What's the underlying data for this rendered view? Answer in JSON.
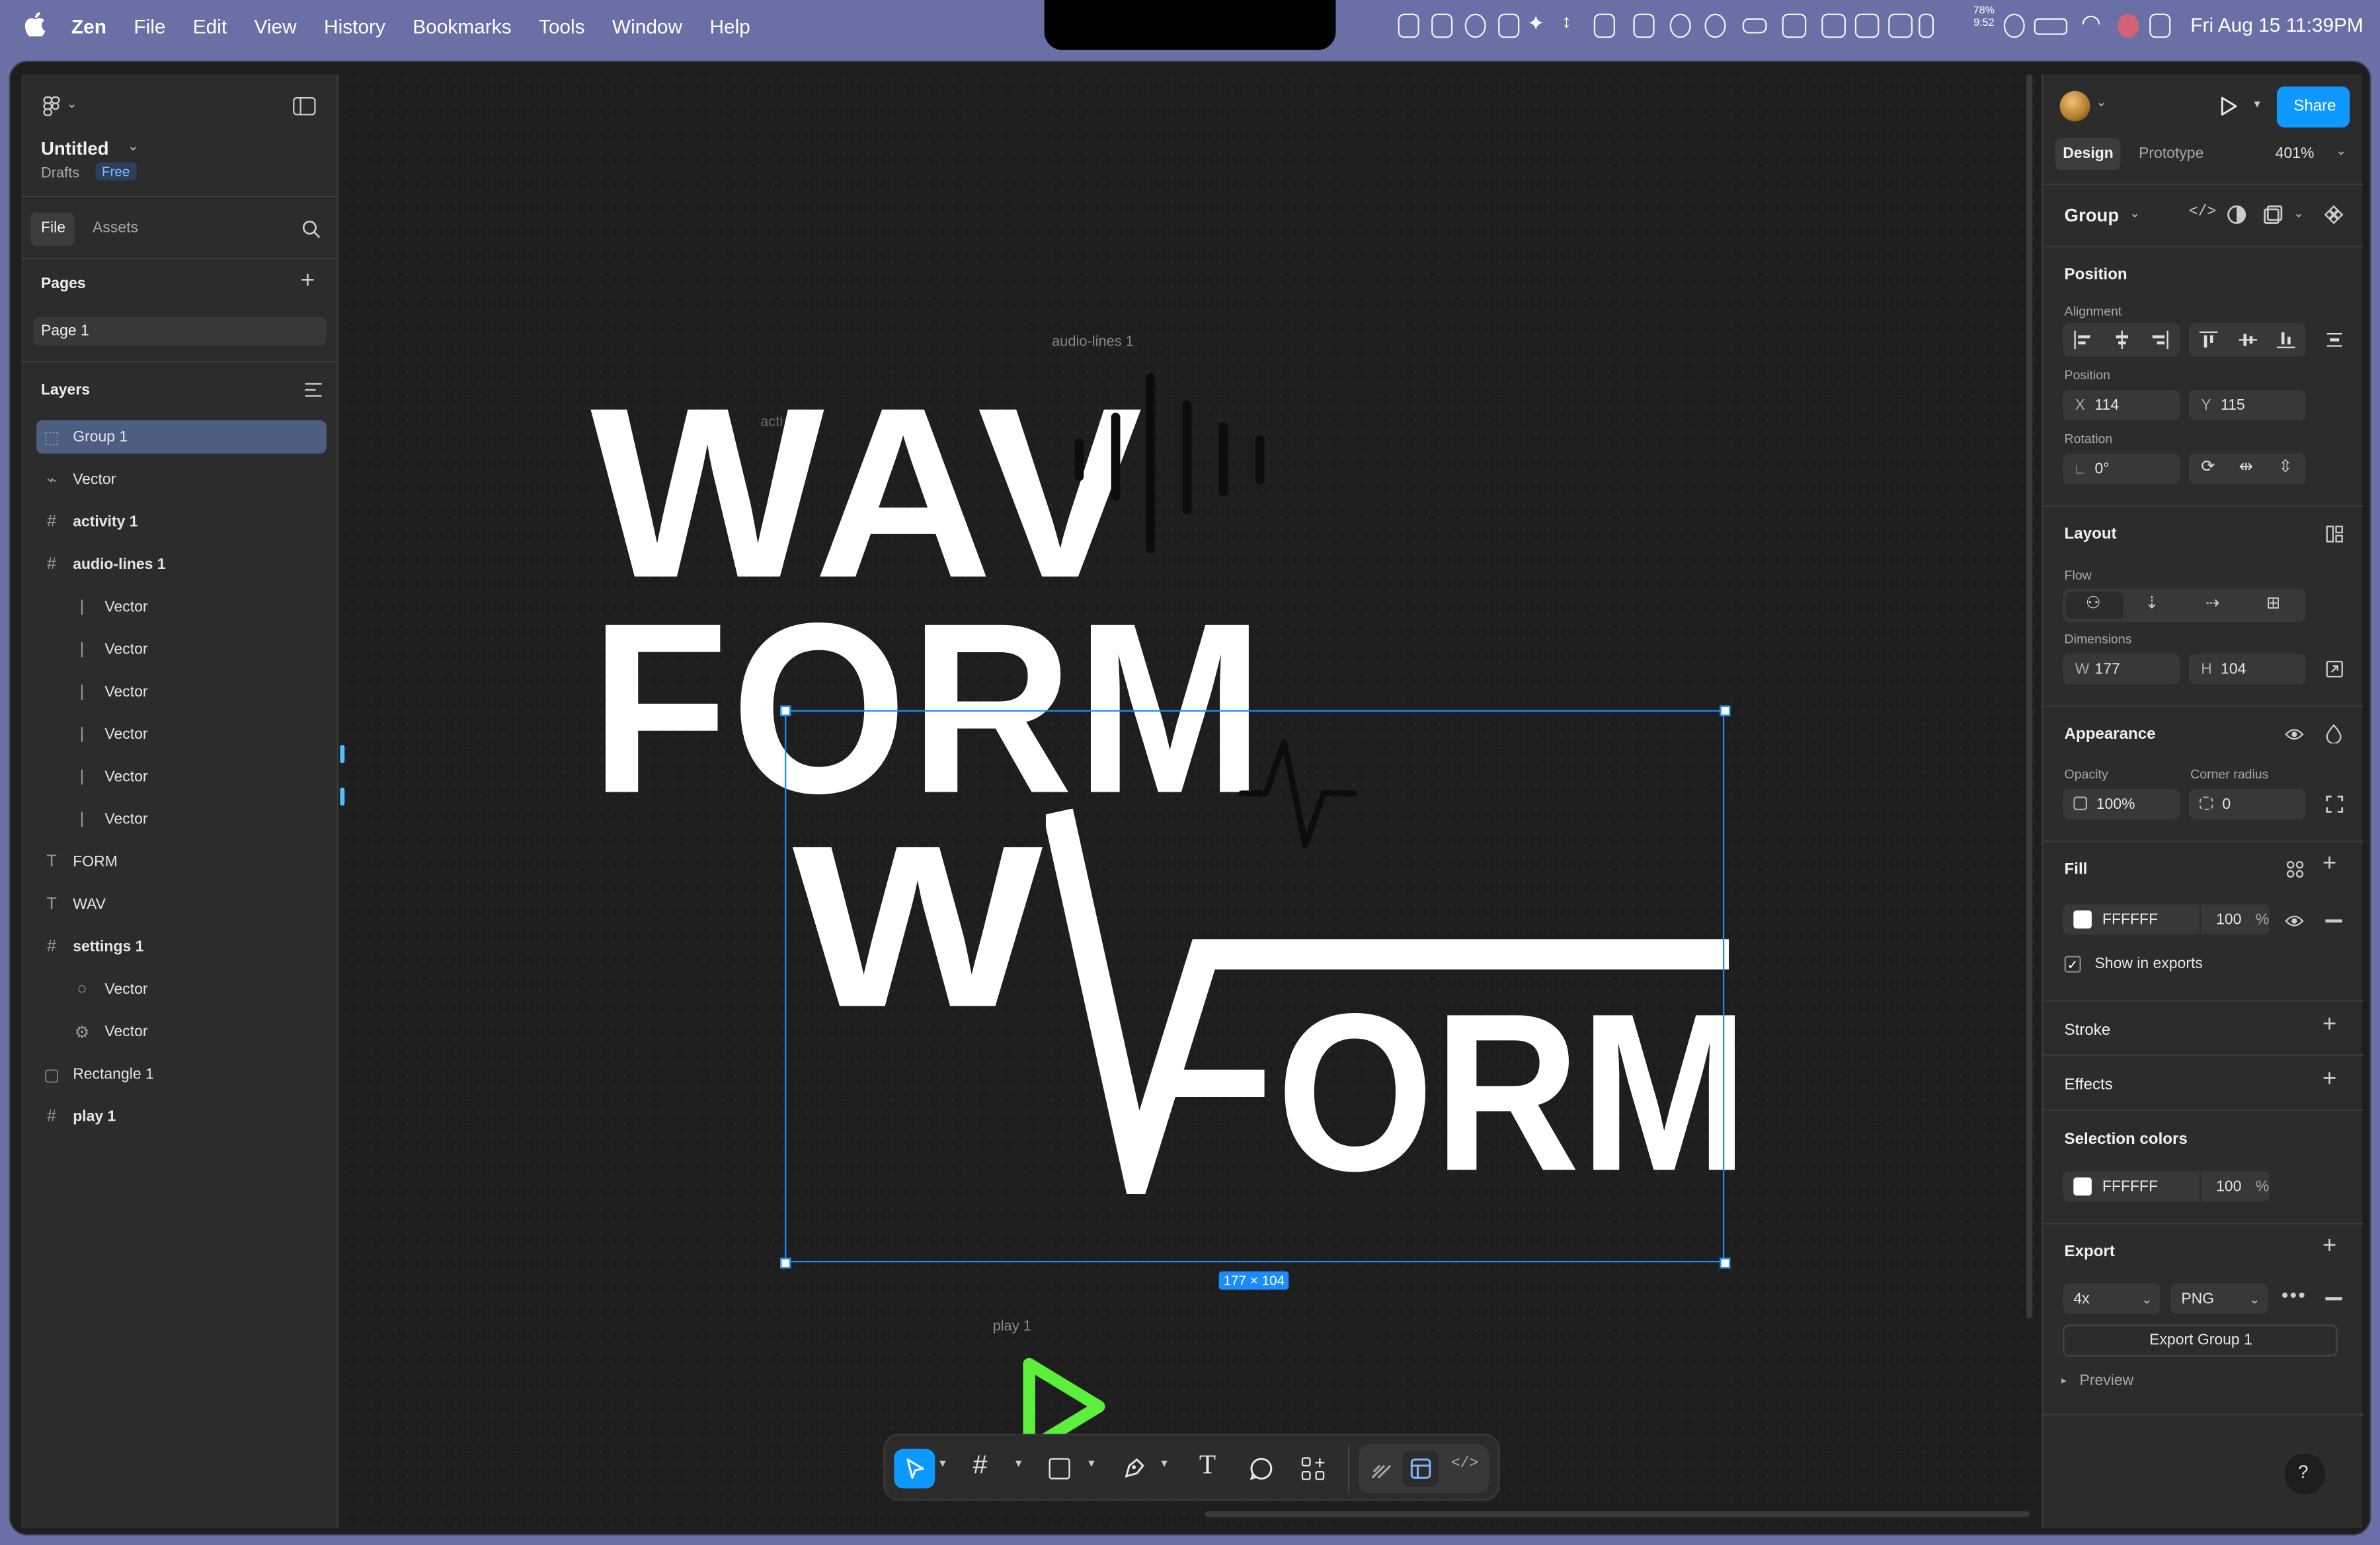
{
  "menubar": {
    "app": "Zen",
    "items": [
      "File",
      "Edit",
      "View",
      "History",
      "Bookmarks",
      "Tools",
      "Window",
      "Help"
    ],
    "battery_pct": "78%",
    "battery_time": "9:52",
    "clock": "Fri Aug 15  11:39PM"
  },
  "file": {
    "title": "Untitled",
    "drafts": "Drafts",
    "plan_badge": "Free"
  },
  "left_tabs": {
    "file": "File",
    "assets": "Assets"
  },
  "pages": {
    "header": "Pages",
    "items": [
      "Page 1"
    ]
  },
  "layers": {
    "header": "Layers",
    "items": [
      {
        "name": "Group 1",
        "glyph": "group-icon",
        "depth": 0,
        "bold": false,
        "selected": true
      },
      {
        "name": "Vector",
        "glyph": "vector-icon",
        "depth": 0,
        "bold": false
      },
      {
        "name": "activity 1",
        "glyph": "frame-icon",
        "depth": 0,
        "bold": true
      },
      {
        "name": "audio-lines 1",
        "glyph": "frame-icon",
        "depth": 0,
        "bold": true
      },
      {
        "name": "Vector",
        "glyph": "line-icon",
        "depth": 1,
        "bold": false
      },
      {
        "name": "Vector",
        "glyph": "line-icon",
        "depth": 1,
        "bold": false
      },
      {
        "name": "Vector",
        "glyph": "line-icon",
        "depth": 1,
        "bold": false
      },
      {
        "name": "Vector",
        "glyph": "line-icon",
        "depth": 1,
        "bold": false
      },
      {
        "name": "Vector",
        "glyph": "line-icon",
        "depth": 1,
        "bold": false
      },
      {
        "name": "Vector",
        "glyph": "line-icon",
        "depth": 1,
        "bold": false
      },
      {
        "name": "FORM",
        "glyph": "text-icon",
        "depth": 0,
        "bold": false
      },
      {
        "name": "WAV",
        "glyph": "text-icon",
        "depth": 0,
        "bold": false
      },
      {
        "name": "settings 1",
        "glyph": "frame-icon",
        "depth": 0,
        "bold": true
      },
      {
        "name": "Vector",
        "glyph": "circle-icon",
        "depth": 1,
        "bold": false
      },
      {
        "name": "Vector",
        "glyph": "gear-icon",
        "depth": 1,
        "bold": false
      },
      {
        "name": "Rectangle 1",
        "glyph": "rectangle-icon",
        "depth": 0,
        "bold": false
      },
      {
        "name": "play 1",
        "glyph": "frame-icon",
        "depth": 0,
        "bold": true
      }
    ]
  },
  "canvas": {
    "frame_label_audio": "audio-lines 1",
    "frame_label_activity": "acti",
    "frame_label_play": "play 1",
    "wav": "WAV",
    "form": "FORM",
    "logo_w": "W",
    "logo_orm": "ORM",
    "size_badge": "177 × 104"
  },
  "right": {
    "share": "Share",
    "tab_design": "Design",
    "tab_prototype": "Prototype",
    "zoom": "401%",
    "selection_type": "Group",
    "position": {
      "header": "Position",
      "alignment_label": "Alignment",
      "position_label": "Position",
      "x_label": "X",
      "x": "114",
      "y_label": "Y",
      "y": "115",
      "rotation_label": "Rotation",
      "rotation": "0°"
    },
    "layout": {
      "header": "Layout",
      "flow_label": "Flow",
      "dimensions_label": "Dimensions",
      "w_label": "W",
      "w": "177",
      "h_label": "H",
      "h": "104"
    },
    "appearance": {
      "header": "Appearance",
      "opacity_label": "Opacity",
      "opacity": "100%",
      "radius_label": "Corner radius",
      "radius": "0"
    },
    "fill": {
      "header": "Fill",
      "hex": "FFFFFF",
      "opacity": "100",
      "pct": "%",
      "show_in_exports": "Show in exports"
    },
    "stroke": {
      "header": "Stroke"
    },
    "effects": {
      "header": "Effects"
    },
    "selection_colors": {
      "header": "Selection colors",
      "hex": "FFFFFF",
      "opacity": "100",
      "pct": "%"
    },
    "export": {
      "header": "Export",
      "scale": "4x",
      "format": "PNG",
      "button": "Export Group 1",
      "preview": "Preview"
    }
  },
  "help": "?",
  "colors": {
    "accent": "#0d99ff",
    "selection": "#1a8cff",
    "play": "#5cf03c",
    "layer_selected": "#4d5e80"
  }
}
